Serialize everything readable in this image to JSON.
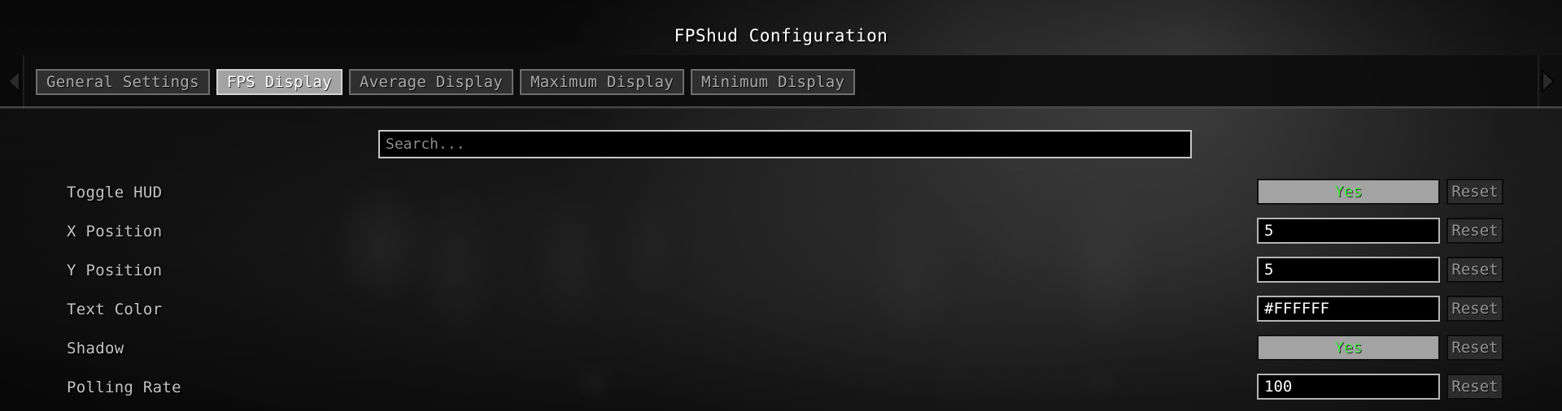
{
  "window": {
    "title": "FPShud Configuration"
  },
  "nav": {
    "prev_icon": "triangle-left-icon",
    "next_icon": "triangle-right-icon"
  },
  "tabs": [
    {
      "label": "General Settings",
      "active": false
    },
    {
      "label": "FPS Display",
      "active": true
    },
    {
      "label": "Average Display",
      "active": false
    },
    {
      "label": "Maximum Display",
      "active": false
    },
    {
      "label": "Minimum Display",
      "active": false
    }
  ],
  "search": {
    "value": "",
    "placeholder": "Search..."
  },
  "reset_label": "Reset",
  "settings": [
    {
      "label": "Toggle HUD",
      "type": "toggle",
      "value": "Yes",
      "reset": "Reset"
    },
    {
      "label": "X Position",
      "type": "text",
      "value": "5",
      "reset": "Reset"
    },
    {
      "label": "Y Position",
      "type": "text",
      "value": "5",
      "reset": "Reset"
    },
    {
      "label": "Text Color",
      "type": "text",
      "value": "#FFFFFF",
      "reset": "Reset"
    },
    {
      "label": "Shadow",
      "type": "toggle",
      "value": "Yes",
      "reset": "Reset"
    },
    {
      "label": "Polling Rate",
      "type": "text",
      "value": "100",
      "reset": "Reset"
    }
  ],
  "colors": {
    "toggle_on_text": "#4FE24F",
    "field_text": "#FFFFFF",
    "label_text": "#C2C2C2",
    "tab_active_bg": "#A3A3A3",
    "tab_inactive_bg": "#2F2F2F",
    "reset_text": "#949494"
  }
}
